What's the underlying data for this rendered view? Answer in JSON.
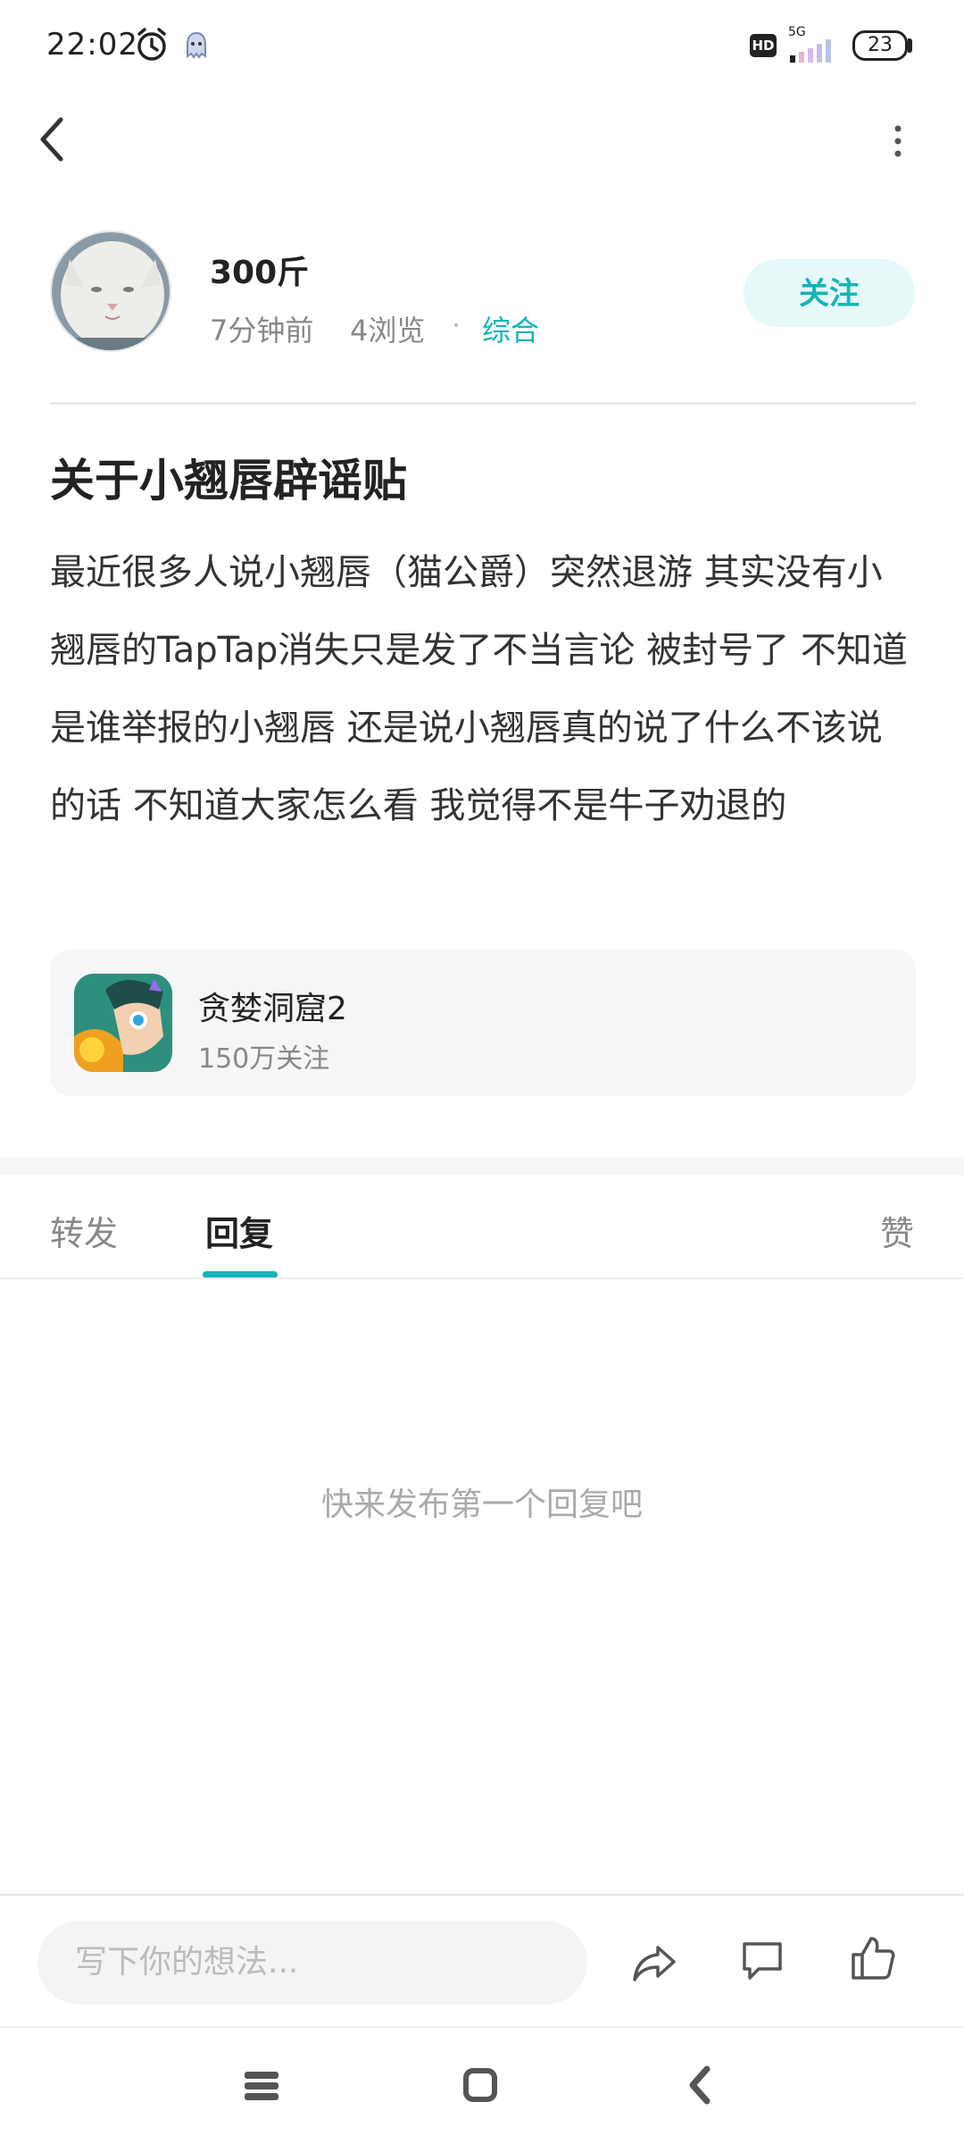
{
  "status_bar": {
    "time": "22:02",
    "network": "5G",
    "hd": "HD",
    "battery": "23"
  },
  "post": {
    "author": "300斤",
    "time_ago": "7分钟前",
    "views": "4浏览",
    "separator": "·",
    "category": "综合",
    "follow_label": "关注",
    "title": "关于小翘唇辟谣贴",
    "body": "最近很多人说小翘唇（猫公爵）突然退游 其实没有小翘唇的TapTap消失只是发了不当言论 被封号了 不知道是谁举报的小翘唇 还是说小翘唇真的说了什么不该说的话 不知道大家怎么看 我觉得不是牛子劝退的"
  },
  "game": {
    "name": "贪婪洞窟2",
    "followers": "150万关注"
  },
  "tabs": {
    "forward": "转发",
    "reply": "回复",
    "like": "赞"
  },
  "empty_state": "快来发布第一个回复吧",
  "bottom_bar": {
    "input_placeholder": "写下你的想法..."
  },
  "colors": {
    "accent": "#15b4b7",
    "follow_bg": "#e6f8f8",
    "card_bg": "#f5f6f7"
  },
  "icons": [
    "back-icon",
    "more-icon",
    "share-icon",
    "comment-icon",
    "like-icon",
    "alarm-icon",
    "ghost-icon"
  ]
}
